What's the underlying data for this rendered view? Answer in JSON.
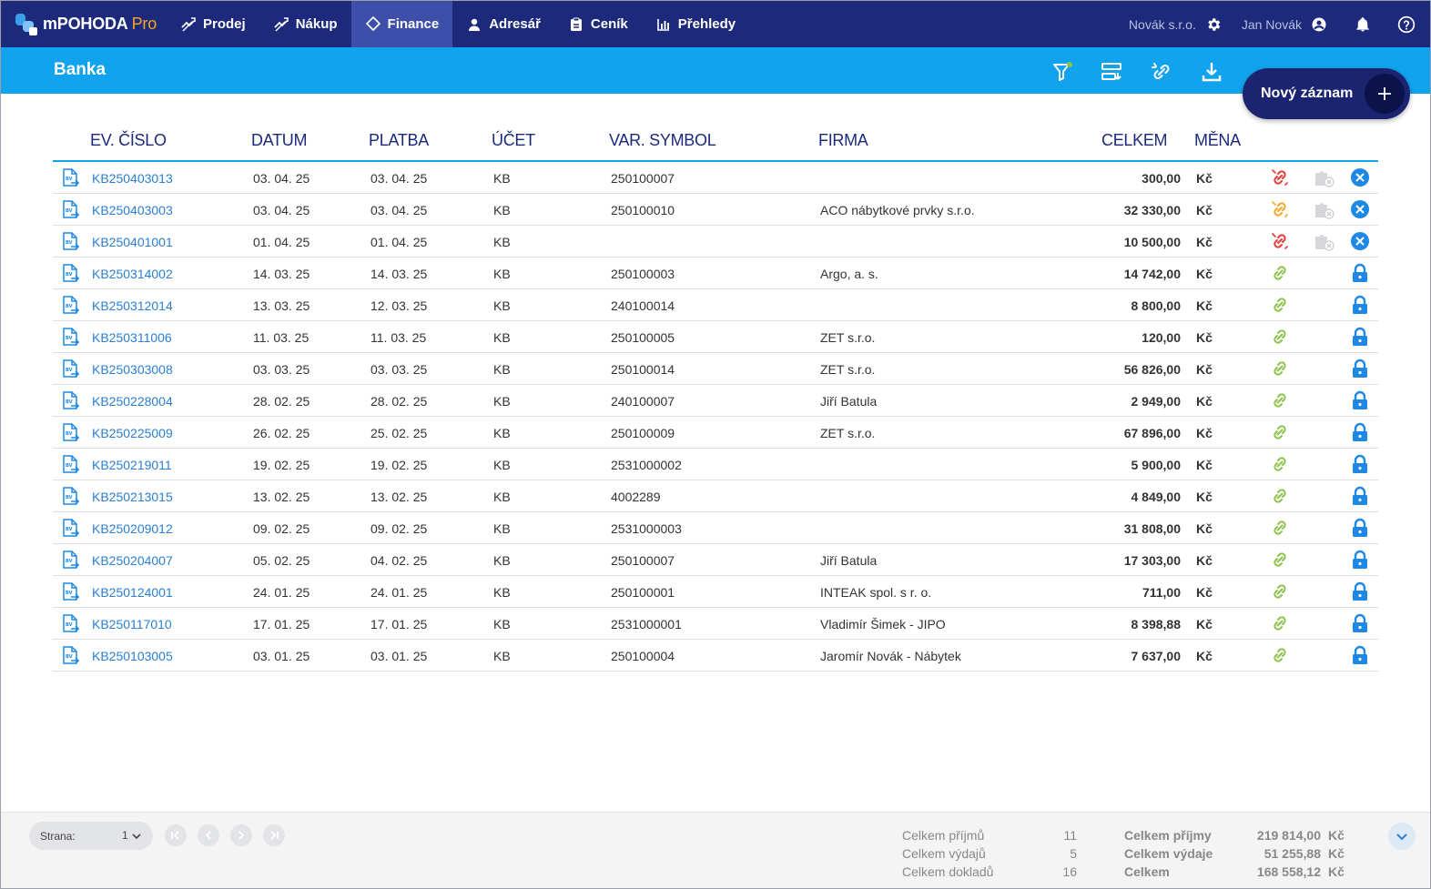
{
  "app": {
    "name": "mPOHODA",
    "edition": "Pro"
  },
  "nav": [
    {
      "key": "prodej",
      "label": "Prodej",
      "active": false
    },
    {
      "key": "nakup",
      "label": "Nákup",
      "active": false
    },
    {
      "key": "finance",
      "label": "Finance",
      "active": true
    },
    {
      "key": "adresar",
      "label": "Adresář",
      "active": false
    },
    {
      "key": "cenik",
      "label": "Ceník",
      "active": false
    },
    {
      "key": "prehledy",
      "label": "Přehledy",
      "active": false
    }
  ],
  "topRight": {
    "company": "Novák s.r.o.",
    "user": "Jan Novák"
  },
  "page": {
    "title": "Banka",
    "newButton": "Nový záznam"
  },
  "columns": {
    "ev": "EV. ČÍSLO",
    "datum": "DATUM",
    "platba": "PLATBA",
    "ucet": "ÚČET",
    "var": "VAR. SYMBOL",
    "firma": "FIRMA",
    "celkem": "CELKEM",
    "mena": "MĚNA"
  },
  "rows": [
    {
      "ev": "KB250403013",
      "datum": "03. 04. 25",
      "platba": "03. 04. 25",
      "ucet": "KB",
      "var": "250100007",
      "firma": "",
      "celkem": "300,00",
      "mena": "Kč",
      "link": "red",
      "state": "open"
    },
    {
      "ev": "KB250403003",
      "datum": "03. 04. 25",
      "platba": "03. 04. 25",
      "ucet": "KB",
      "var": "250100010",
      "firma": "ACO nábytkové prvky s.r.o.",
      "celkem": "32 330,00",
      "mena": "Kč",
      "link": "orange",
      "state": "open"
    },
    {
      "ev": "KB250401001",
      "datum": "01. 04. 25",
      "platba": "01. 04. 25",
      "ucet": "KB",
      "var": "",
      "firma": "",
      "celkem": "10 500,00",
      "mena": "Kč",
      "link": "red",
      "state": "open"
    },
    {
      "ev": "KB250314002",
      "datum": "14. 03. 25",
      "platba": "14. 03. 25",
      "ucet": "KB",
      "var": "250100003",
      "firma": "Argo, a. s.",
      "celkem": "14 742,00",
      "mena": "Kč",
      "link": "green",
      "state": "locked"
    },
    {
      "ev": "KB250312014",
      "datum": "13. 03. 25",
      "platba": "12. 03. 25",
      "ucet": "KB",
      "var": "240100014",
      "firma": "",
      "celkem": "8 800,00",
      "mena": "Kč",
      "link": "green",
      "state": "locked"
    },
    {
      "ev": "KB250311006",
      "datum": "11. 03. 25",
      "platba": "11. 03. 25",
      "ucet": "KB",
      "var": "250100005",
      "firma": "ZET s.r.o.",
      "celkem": "120,00",
      "mena": "Kč",
      "link": "green",
      "state": "locked"
    },
    {
      "ev": "KB250303008",
      "datum": "03. 03. 25",
      "platba": "03. 03. 25",
      "ucet": "KB",
      "var": "250100014",
      "firma": "ZET s.r.o.",
      "celkem": "56 826,00",
      "mena": "Kč",
      "link": "green",
      "state": "locked"
    },
    {
      "ev": "KB250228004",
      "datum": "28. 02. 25",
      "platba": "28. 02. 25",
      "ucet": "KB",
      "var": "240100007",
      "firma": "Jiří Batula",
      "celkem": "2 949,00",
      "mena": "Kč",
      "link": "green",
      "state": "locked"
    },
    {
      "ev": "KB250225009",
      "datum": "26. 02. 25",
      "platba": "25. 02. 25",
      "ucet": "KB",
      "var": "250100009",
      "firma": "ZET s.r.o.",
      "celkem": "67 896,00",
      "mena": "Kč",
      "link": "green",
      "state": "locked"
    },
    {
      "ev": "KB250219011",
      "datum": "19. 02. 25",
      "platba": "19. 02. 25",
      "ucet": "KB",
      "var": "2531000002",
      "firma": "",
      "celkem": "5 900,00",
      "mena": "Kč",
      "link": "green",
      "state": "locked"
    },
    {
      "ev": "KB250213015",
      "datum": "13. 02. 25",
      "platba": "13. 02. 25",
      "ucet": "KB",
      "var": "4002289",
      "firma": "",
      "celkem": "4 849,00",
      "mena": "Kč",
      "link": "green",
      "state": "locked"
    },
    {
      "ev": "KB250209012",
      "datum": "09. 02. 25",
      "platba": "09. 02. 25",
      "ucet": "KB",
      "var": "2531000003",
      "firma": "",
      "celkem": "31 808,00",
      "mena": "Kč",
      "link": "green",
      "state": "locked"
    },
    {
      "ev": "KB250204007",
      "datum": "05. 02. 25",
      "platba": "04. 02. 25",
      "ucet": "KB",
      "var": "250100007",
      "firma": "Jiří Batula",
      "celkem": "17 303,00",
      "mena": "Kč",
      "link": "green",
      "state": "locked"
    },
    {
      "ev": "KB250124001",
      "datum": "24. 01. 25",
      "platba": "24. 01. 25",
      "ucet": "KB",
      "var": "250100001",
      "firma": "INTEAK spol. s r. o.",
      "celkem": "711,00",
      "mena": "Kč",
      "link": "green",
      "state": "locked"
    },
    {
      "ev": "KB250117010",
      "datum": "17. 01. 25",
      "platba": "17. 01. 25",
      "ucet": "KB",
      "var": "2531000001",
      "firma": "Vladimír Šimek - JIPO",
      "celkem": "8 398,88",
      "mena": "Kč",
      "link": "green",
      "state": "locked"
    },
    {
      "ev": "KB250103005",
      "datum": "03. 01. 25",
      "platba": "03. 01. 25",
      "ucet": "KB",
      "var": "250100004",
      "firma": "Jaromír Novák - Nábytek",
      "celkem": "7 637,00",
      "mena": "Kč",
      "link": "green",
      "state": "locked"
    }
  ],
  "footer": {
    "pagerLabel": "Strana:",
    "pagerValue": "1",
    "counts": [
      {
        "label": "Celkem příjmů",
        "value": "11"
      },
      {
        "label": "Celkem výdajů",
        "value": "5"
      },
      {
        "label": "Celkem dokladů",
        "value": "16"
      }
    ],
    "totals": [
      {
        "label": "Celkem příjmy",
        "value": "219 814,00",
        "currency": "Kč"
      },
      {
        "label": "Celkem výdaje",
        "value": "51 255,88",
        "currency": "Kč"
      },
      {
        "label": "Celkem",
        "value": "168 558,12",
        "currency": "Kč"
      }
    ]
  },
  "colors": {
    "navy": "#1d2a7c",
    "active": "#3d4fa8",
    "cyan": "#12a3ee",
    "link": "#2a7fd4",
    "red": "#e53935",
    "orange": "#f5a623",
    "green": "#8bc34a",
    "lockBlue": "#1e88e5"
  }
}
